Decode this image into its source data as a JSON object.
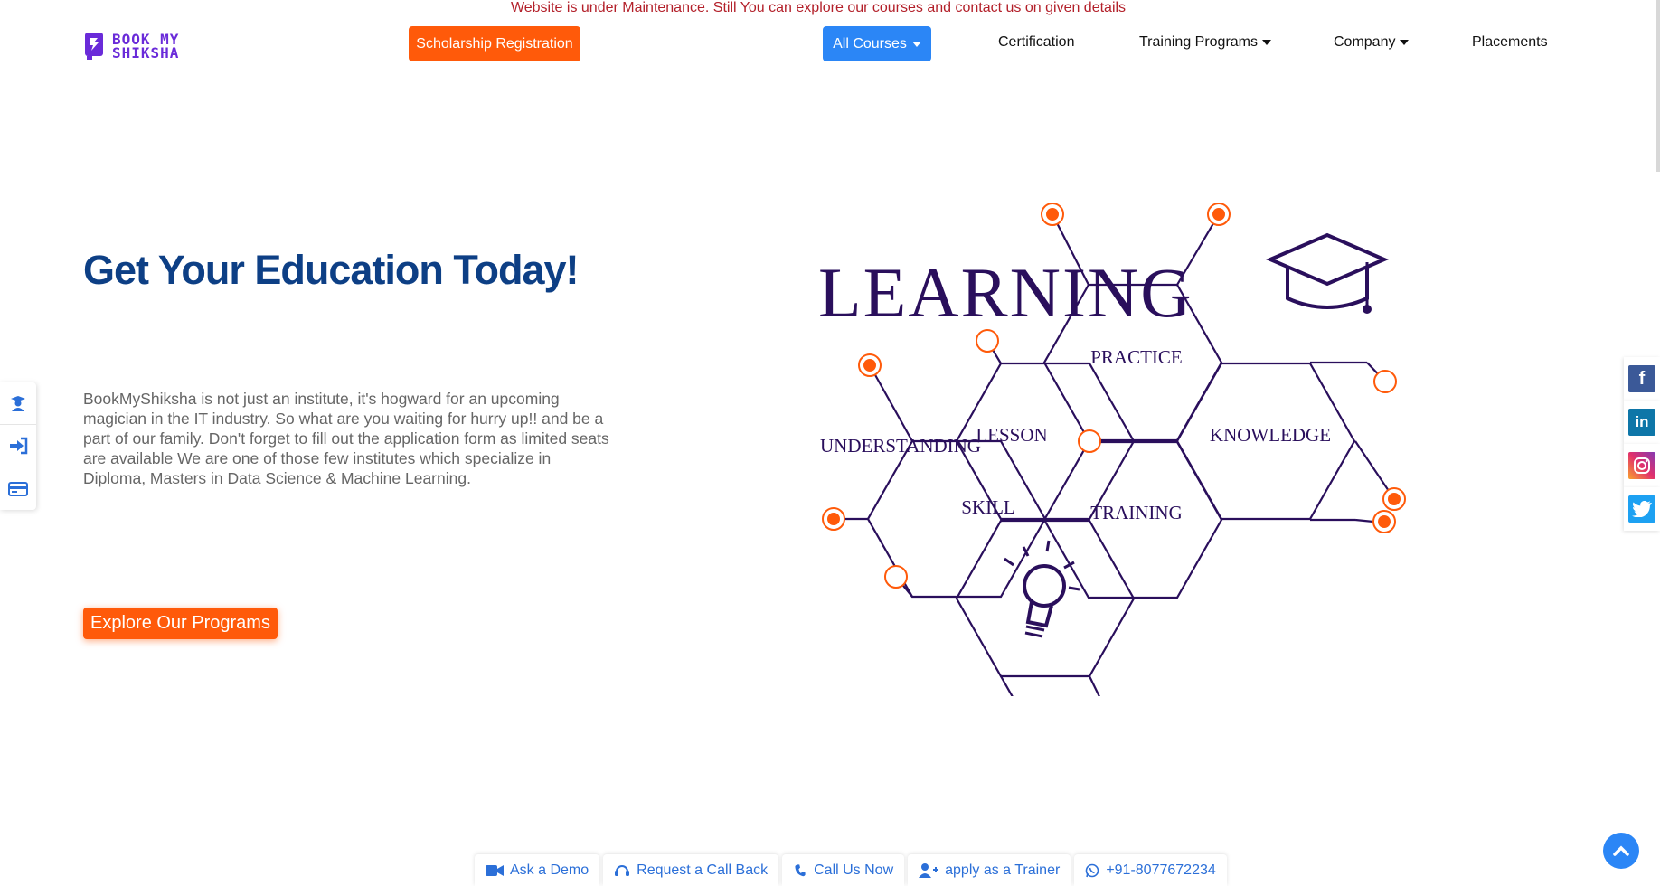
{
  "banner": {
    "text": "Website is under Maintenance. Still You can explore our courses and contact us on given details"
  },
  "logo": {
    "line1": "BOOK MY",
    "line2": "SHIKSHA",
    "icon": "bookmyshiksha-logo-icon"
  },
  "header": {
    "scholarship_label": "Scholarship Registration",
    "all_courses_label": "All Courses",
    "nav": {
      "certification": "Certification",
      "training": "Training Programs",
      "company": "Company",
      "placements": "Placements"
    }
  },
  "hero": {
    "title": "Get Your Education Today!",
    "description": "BookMyShiksha is not just an institute, it's hogward for an upcoming magician in the IT industry. So what are you waiting for hurry up!! and be a part of our family. Don't forget to fill out the application form as limited seats are available We are one of those few institutes which specialize in Diploma, Masters in Data Science & Machine Learning.",
    "cta_label": "Explore Our Programs"
  },
  "illustration": {
    "heading": "LEARNING",
    "labels": {
      "practice": "PRACTICE",
      "lesson": "LESSON",
      "knowledge": "KNOWLEDGE",
      "understanding": "UNDERSTANDING",
      "skill": "SKILL",
      "training": "TRAINING"
    },
    "icons": [
      "graduation-cap-icon",
      "lightbulb-icon"
    ]
  },
  "left_toolbar": {
    "icons": [
      "student-icon",
      "login-icon",
      "payment-card-icon"
    ]
  },
  "social": {
    "icons": [
      "facebook-icon",
      "linkedin-icon",
      "instagram-icon",
      "twitter-icon"
    ]
  },
  "bottom_bar": {
    "demo": "Ask a Demo",
    "callback": "Request a Call Back",
    "call": "Call Us Now",
    "trainer": "apply as a Trainer",
    "phone": "+91-8077672234"
  },
  "colors": {
    "brand_orange": "#ff5a0a",
    "brand_blue": "#2b86f6",
    "title_blue": "#0d3f85",
    "illustration_purple": "#2a0f5c",
    "logo_purple": "#6a2bd9"
  }
}
